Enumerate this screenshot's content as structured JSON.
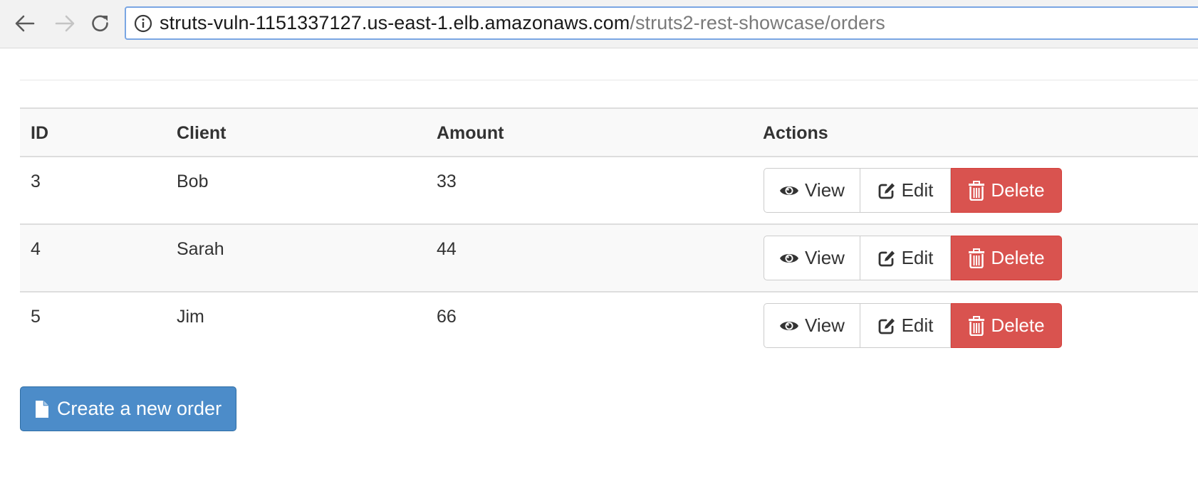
{
  "browser": {
    "url_host": "struts-vuln-1151337127.us-east-1.elb.amazonaws.com",
    "url_path": "/struts2-rest-showcase/orders"
  },
  "table": {
    "headers": {
      "id": "ID",
      "client": "Client",
      "amount": "Amount",
      "actions": "Actions"
    },
    "rows": [
      {
        "id": "3",
        "client": "Bob",
        "amount": "33"
      },
      {
        "id": "4",
        "client": "Sarah",
        "amount": "44"
      },
      {
        "id": "5",
        "client": "Jim",
        "amount": "66"
      }
    ],
    "actions": {
      "view": "View",
      "edit": "Edit",
      "delete": "Delete"
    }
  },
  "create_button": {
    "label": "Create a new order"
  },
  "icons": {
    "back": "arrow-left-icon",
    "forward": "arrow-right-icon",
    "reload": "reload-icon",
    "info": "info-circle-icon",
    "view": "eye-icon",
    "edit": "edit-icon",
    "delete": "trash-icon",
    "create": "file-icon"
  },
  "colors": {
    "danger": "#d9534f",
    "primary": "#4c8cc9",
    "url_focus": "#7aa6e3"
  }
}
